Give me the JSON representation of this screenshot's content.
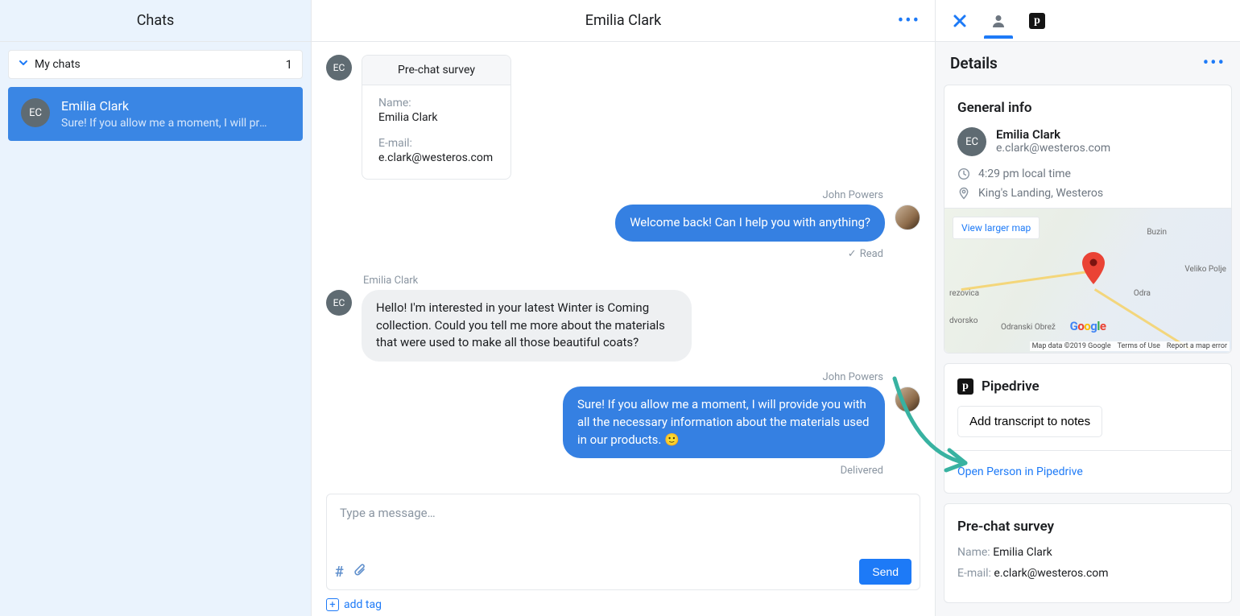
{
  "sidebar": {
    "title": "Chats",
    "filter_label": "My chats",
    "filter_count": "1",
    "item": {
      "initials": "EC",
      "name": "Emilia Clark",
      "preview": "Sure! If you allow me a moment, I will pro…"
    }
  },
  "conversation": {
    "title": "Emilia Clark",
    "survey": {
      "title": "Pre-chat survey",
      "name_label": "Name:",
      "name_value": "Emilia Clark",
      "email_label": "E-mail:",
      "email_value": "e.clark@westeros.com"
    },
    "msg1_sender": "John Powers",
    "msg1_text": "Welcome back! Can I help you with anything?",
    "msg1_status": "Read",
    "msg2_sender": "Emilia Clark",
    "msg2_text": "Hello! I'm interested in your latest Winter is Coming collection. Could you tell me more about the materials that were used to make all those beautiful coats?",
    "msg3_sender": "John Powers",
    "msg3_text": "Sure! If you allow me a moment, I will provide you with all the necessary information about the materials used in our products. 🙂",
    "msg3_status": "Delivered",
    "composer_placeholder": "Type a message…",
    "send_label": "Send",
    "add_tag_label": "add tag",
    "contact_initials": "EC"
  },
  "details": {
    "title": "Details",
    "general": {
      "heading": "General info",
      "name": "Emilia Clark",
      "email": "e.clark@westeros.com",
      "local_time": "4:29 pm local time",
      "location": "King's Landing, Westeros",
      "view_larger": "View larger map",
      "map_attrib_data": "Map data ©2019 Google",
      "map_attrib_terms": "Terms of Use",
      "map_attrib_report": "Report a map error",
      "city_buzin": "Buzin",
      "city_polje": "Veliko Polje",
      "city_rezovica": "rezovica",
      "city_dvorsko": "dvorsko",
      "city_odra": "Odra",
      "city_obrez": "Odranski Obrež"
    },
    "pipedrive": {
      "heading": "Pipedrive",
      "button": "Add transcript to notes",
      "link": "Open Person in Pipedrive"
    },
    "survey": {
      "heading": "Pre-chat survey",
      "name_label": "Name:",
      "name_value": "Emilia Clark",
      "email_label": "E-mail:",
      "email_value": "e.clark@westeros.com"
    }
  }
}
